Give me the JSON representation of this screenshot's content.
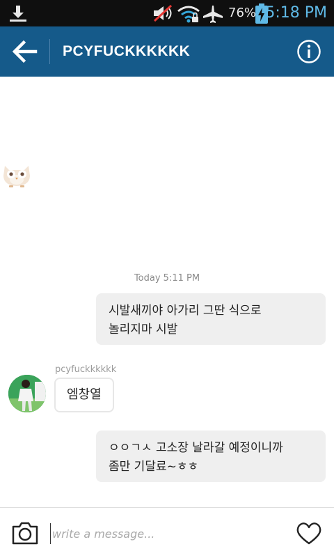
{
  "status_bar": {
    "battery": "76%",
    "time": "5:18 PM"
  },
  "header": {
    "title": "PCYFUCKKKKKK"
  },
  "conversation": {
    "timestamp": "Today 5:11 PM",
    "messages": [
      {
        "side": "right",
        "lines": [
          "시발새끼야 아가리 그딴 식으로",
          "놀리지마 시발"
        ]
      },
      {
        "side": "left",
        "sender": "pcyfuckkkkkk",
        "text": "엠창열"
      },
      {
        "side": "right",
        "lines": [
          "ㅇㅇㄱㅅ 고소장 날라갈 예정이니까",
          "좀만 기달료~ㅎㅎ"
        ]
      }
    ]
  },
  "composer": {
    "placeholder": "write a message..."
  },
  "colors": {
    "header_bg": "#155a8a",
    "status_bar_bg": "#0f0f0f",
    "time_color": "#5fb9e6",
    "bubble_bg": "#efefef"
  },
  "icons": {
    "status_bar": [
      "download-icon",
      "mute-icon",
      "wifi-icon",
      "airplane-icon",
      "battery-charging-icon"
    ],
    "header": [
      "back-arrow-icon",
      "info-icon"
    ],
    "composer": [
      "camera-icon",
      "heart-icon"
    ]
  }
}
